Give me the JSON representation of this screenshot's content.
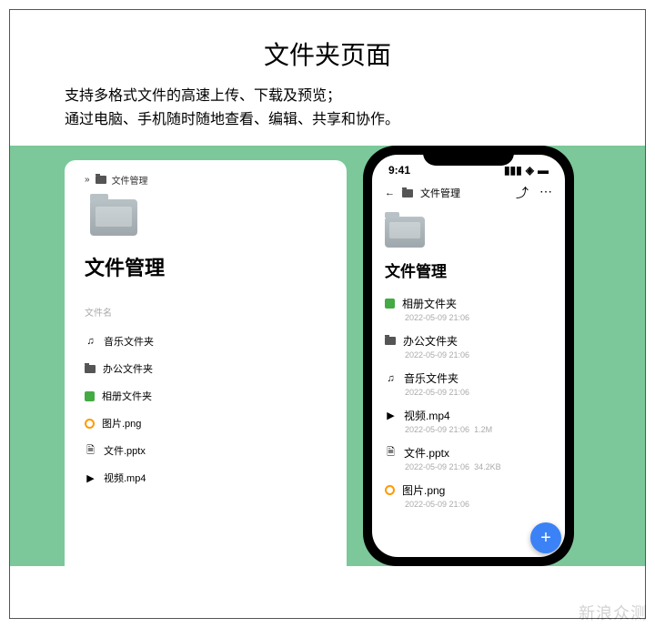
{
  "page": {
    "title": "文件夹页面",
    "desc_line1": "支持多格式文件的高速上传、下载及预览；",
    "desc_line2": "通过电脑、手机随时随地查看、编辑、共享和协作。"
  },
  "desktop": {
    "breadcrumb_icon": "»",
    "breadcrumb": "文件管理",
    "title": "文件管理",
    "column_header": "文件名",
    "items": [
      {
        "icon": "music-icon",
        "name": "音乐文件夹"
      },
      {
        "icon": "folder-icon",
        "name": "办公文件夹"
      },
      {
        "icon": "photo-icon",
        "name": "相册文件夹"
      },
      {
        "icon": "image-icon",
        "name": "图片.png"
      },
      {
        "icon": "file-icon",
        "name": "文件.pptx"
      },
      {
        "icon": "video-icon",
        "name": "视频.mp4"
      }
    ]
  },
  "mobile": {
    "status_time": "9:41",
    "breadcrumb": "文件管理",
    "title": "文件管理",
    "items": [
      {
        "icon": "photo-icon",
        "name": "相册文件夹",
        "date": "2022-05-09 21:06",
        "size": ""
      },
      {
        "icon": "folder-icon",
        "name": "办公文件夹",
        "date": "2022-05-09 21:06",
        "size": ""
      },
      {
        "icon": "music-icon",
        "name": "音乐文件夹",
        "date": "2022-05-09 21:06",
        "size": ""
      },
      {
        "icon": "video-icon",
        "name": "视频.mp4",
        "date": "2022-05-09 21:06",
        "size": "1.2M"
      },
      {
        "icon": "file-icon",
        "name": "文件.pptx",
        "date": "2022-05-09 21:06",
        "size": "34.2KB"
      },
      {
        "icon": "image-icon",
        "name": "图片.png",
        "date": "2022-05-09 21:06",
        "size": ""
      }
    ],
    "fab_label": "+"
  },
  "watermark": "新浪众测"
}
